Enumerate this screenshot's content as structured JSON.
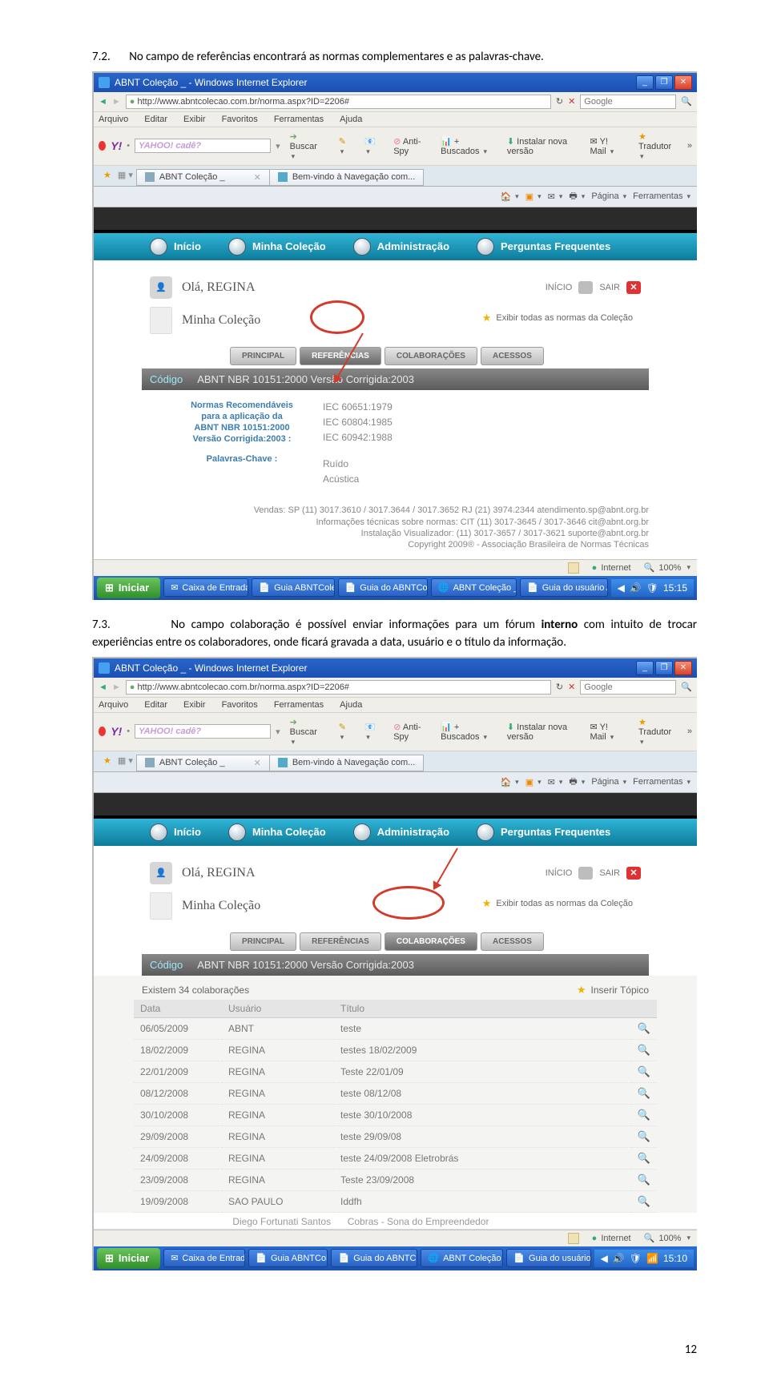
{
  "doc": {
    "para1_num": "7.2.",
    "para1_text": "No campo de referências encontrará as normas complementares e as palavras-chave.",
    "para2_num": "7.3.",
    "para2_lead": "No campo colaboração é possível  enviar informações para um fórum ",
    "para2_bold": "interno",
    "para2_tail": " com intuito de trocar experiências entre os colaboradores, onde ficará gravada a data, usuário e o título da informação.",
    "page_number": "12"
  },
  "os": {
    "title": "ABNT Coleção _ - Windows Internet Explorer",
    "url": "http://www.abntcolecao.com.br/norma.aspx?ID=2206#",
    "search_placeholder": "Google",
    "menu": [
      "Arquivo",
      "Editar",
      "Exibir",
      "Favoritos",
      "Ferramentas",
      "Ajuda"
    ],
    "yahoo_placeholder": "YAHOO! cadê?",
    "tb_buscar": "Buscar",
    "tb_antispy": "Anti-Spy",
    "tb_buscados": "+ Buscados",
    "tb_instalar": "Instalar nova versão",
    "tb_ymail": "Y! Mail",
    "tb_tradutor": "Tradutor",
    "tabs": [
      "ABNT Coleção _",
      "Bem-vindo à Navegação com..."
    ],
    "toolrow": {
      "pagina": "Página",
      "ferramentas": "Ferramentas"
    },
    "status": {
      "internet": "Internet",
      "zoom": "100%"
    },
    "taskbar": {
      "start": "Iniciar",
      "buttons": [
        "Caixa de Entrada - ...",
        "Guia ABNTColeção",
        "Guia do ABNTColeç...",
        "ABNT Coleção _ - ...",
        "Guia do usuário AB..."
      ],
      "clock1": "15:15",
      "clock2": "15:10"
    }
  },
  "site": {
    "nav": [
      "Início",
      "Minha Coleção",
      "Administração",
      "Perguntas Frequentes"
    ],
    "greeting": "Olá, REGINA",
    "inicio_link": "INÍCIO",
    "sair_link": "SAIR",
    "section_title": "Minha Coleção",
    "exibir_todas": "Exibir todas as normas da Coleção",
    "subtabs": [
      "PRINCIPAL",
      "REFERÊNCIAS",
      "COLABORAÇÕES",
      "ACESSOS"
    ],
    "code_label": "Código",
    "code_value_1": "ABNT NBR 10151:2000 Versão Corrigida:2003",
    "code_value_2": "ABNT NBR 10151:2000 Versão Corrigida:2003",
    "ref_left_title": "Normas Recomendáveis para a aplicação da ABNT NBR 10151:2000 Versão Corrigida:2003 :",
    "ref_left_keys": "Palavras-Chave :",
    "ref_norms": [
      "IEC 60651:1979",
      "IEC 60804:1985",
      "IEC 60942:1988"
    ],
    "ref_keywords": [
      "Ruído",
      "Acústica"
    ],
    "footer_lines": [
      "Vendas: SP (11) 3017.3610 / 3017.3644 / 3017.3652 RJ (21) 3974.2344 atendimento.sp@abnt.org.br",
      "Informações técnicas sobre normas: CIT (11) 3017-3645 / 3017-3646 cit@abnt.org.br",
      "Instalação Visualizador: (11) 3017-3657 / 3017-3621 suporte@abnt.org.br",
      "Copyright 2009® - Associação Brasileira de Normas Técnicas"
    ],
    "collab_count": "Existem 34 colaborações",
    "insert_topic": "Inserir Tópico",
    "collab_headers": [
      "Data",
      "Usuário",
      "Título"
    ],
    "collab_rows": [
      {
        "date": "06/05/2009",
        "user": "ABNT",
        "title": "teste"
      },
      {
        "date": "18/02/2009",
        "user": "REGINA",
        "title": "testes 18/02/2009"
      },
      {
        "date": "22/01/2009",
        "user": "REGINA",
        "title": "Teste 22/01/09"
      },
      {
        "date": "08/12/2008",
        "user": "REGINA",
        "title": "teste 08/12/08"
      },
      {
        "date": "30/10/2008",
        "user": "REGINA",
        "title": "teste 30/10/2008"
      },
      {
        "date": "29/09/2008",
        "user": "REGINA",
        "title": "teste 29/09/08"
      },
      {
        "date": "24/09/2008",
        "user": "REGINA",
        "title": "teste 24/09/2008 Eletrobrás"
      },
      {
        "date": "23/09/2008",
        "user": "REGINA",
        "title": "Teste 23/09/2008"
      },
      {
        "date": "19/09/2008",
        "user": "SAO PAULO",
        "title": "Iddfh"
      }
    ],
    "collab_cut_user": "Diego Fortunati Santos",
    "collab_cut_title": "Cobras - Sona do Empreendedor"
  }
}
